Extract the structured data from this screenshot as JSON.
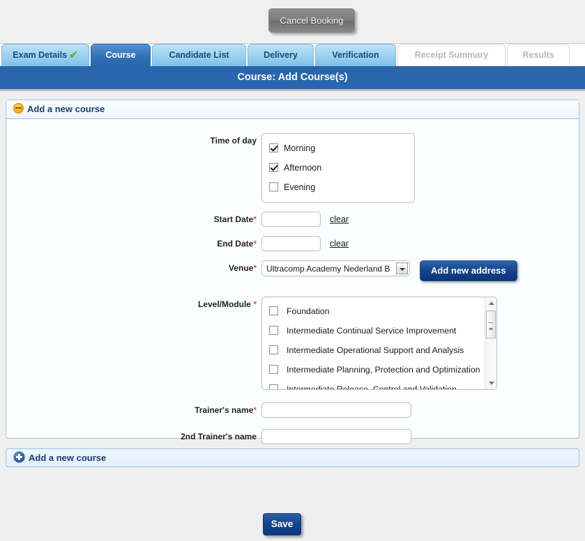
{
  "top_bar": {
    "cancel_booking_label": "Cancel Booking"
  },
  "tabs": [
    {
      "label": "Exam Details",
      "state": "complete",
      "check": "✔"
    },
    {
      "label": "Course",
      "state": "active"
    },
    {
      "label": "Candidate List",
      "state": "enabled"
    },
    {
      "label": "Delivery",
      "state": "enabled"
    },
    {
      "label": "Verification",
      "state": "enabled"
    },
    {
      "label": "Receipt Summary",
      "state": "disabled"
    },
    {
      "label": "Results",
      "state": "disabled"
    }
  ],
  "page_heading": "Course: Add Course(s)",
  "course_panel": {
    "header_label": "Add a new course",
    "time_of_day": {
      "label": "Time of day",
      "required": false,
      "options": [
        {
          "label": "Morning",
          "checked": true
        },
        {
          "label": "Afternoon",
          "checked": true
        },
        {
          "label": "Evening",
          "checked": false
        }
      ]
    },
    "start_date": {
      "label": "Start Date",
      "required": true,
      "value": "",
      "clear_label": "clear"
    },
    "end_date": {
      "label": "End Date",
      "required": true,
      "value": "",
      "clear_label": "clear"
    },
    "venue": {
      "label": "Venue",
      "required": true,
      "selected": "Ultracomp Academy Nederland B",
      "options": [
        "Ultracomp Academy Nederland B"
      ],
      "add_address_label": "Add new address"
    },
    "level_module": {
      "label": "Level/Module",
      "required": true,
      "options": [
        {
          "label": "Foundation",
          "checked": false
        },
        {
          "label": "Intermediate Continual Service Improvement",
          "checked": false
        },
        {
          "label": "Intermediate Operational Support and Analysis",
          "checked": false
        },
        {
          "label": "Intermediate Planning, Protection and Optimization",
          "checked": false
        },
        {
          "label": "Intermediate Release, Control and Validation",
          "checked": false
        }
      ]
    },
    "trainer_name": {
      "label": "Trainer's name",
      "required": true,
      "value": ""
    },
    "second_trainer_name": {
      "label": "2nd Trainer's name",
      "required": false,
      "value": ""
    }
  },
  "add_course_bar": {
    "label": "Add a new course"
  },
  "footer": {
    "save_label": "Save"
  },
  "colors": {
    "accent_blue": "#2a66ab",
    "tab_blue": "#9ed2f0",
    "required_red": "#e8553c",
    "check_green": "#56b731",
    "button_blue": "#13418a",
    "cancel_gray": "#7e7e7e"
  }
}
